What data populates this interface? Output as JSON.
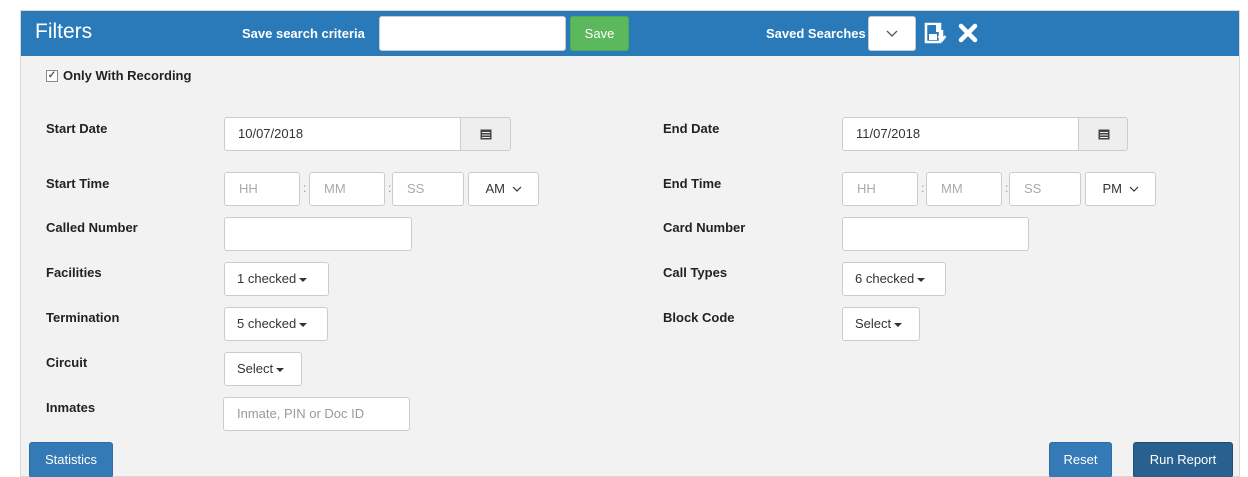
{
  "header": {
    "title": "Filters",
    "save_criteria_label": "Save search criteria",
    "save_criteria_value": "",
    "save_button": "Save",
    "saved_searches_label": "Saved Searches",
    "saved_searches_selected": "",
    "icons": [
      "save-download-icon",
      "close-icon"
    ]
  },
  "only_with_recording": {
    "label": "Only With Recording",
    "checked": true
  },
  "fields": {
    "start_date": {
      "label": "Start Date",
      "value": "10/07/2018"
    },
    "end_date": {
      "label": "End Date",
      "value": "11/07/2018"
    },
    "start_time": {
      "label": "Start Time",
      "hh": "HH",
      "mm": "MM",
      "ss": "SS",
      "ampm": "AM"
    },
    "end_time": {
      "label": "End Time",
      "hh": "HH",
      "mm": "MM",
      "ss": "SS",
      "ampm": "PM"
    },
    "called_number": {
      "label": "Called Number",
      "value": ""
    },
    "card_number": {
      "label": "Card Number",
      "value": ""
    },
    "facilities": {
      "label": "Facilities",
      "value": "1 checked"
    },
    "call_types": {
      "label": "Call Types",
      "value": "6 checked"
    },
    "termination": {
      "label": "Termination",
      "value": "5 checked"
    },
    "block_code": {
      "label": "Block Code",
      "value": "Select"
    },
    "circuit": {
      "label": "Circuit",
      "value": "Select"
    },
    "inmates": {
      "label": "Inmates",
      "placeholder": "Inmate, PIN or Doc ID"
    }
  },
  "buttons": {
    "statistics": "Statistics",
    "reset": "Reset",
    "run_report": "Run Report"
  },
  "colors": {
    "header_bg": "#2a7ab9",
    "save_green": "#5cb85c",
    "primary_blue": "#337ab7",
    "panel_bg": "#f2f2f2"
  }
}
